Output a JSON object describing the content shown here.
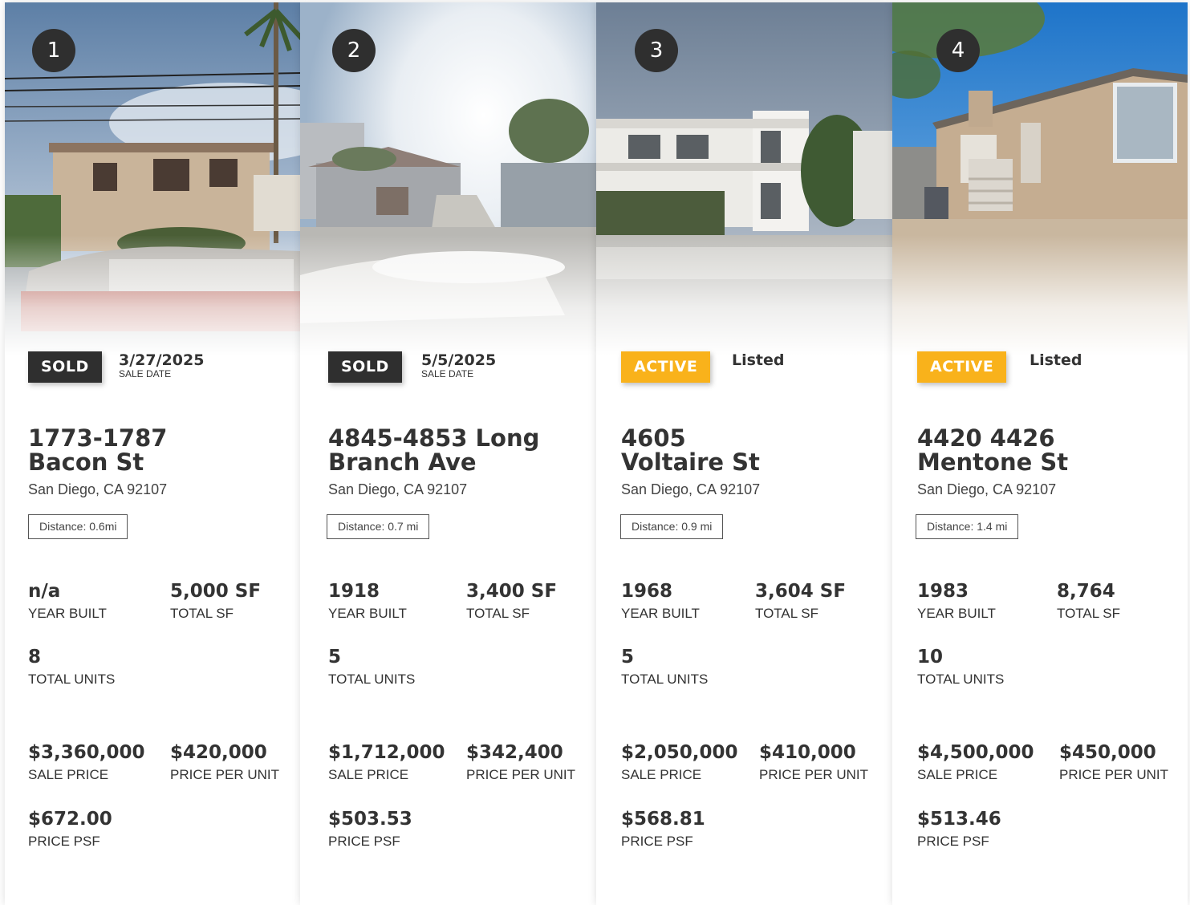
{
  "cards": [
    {
      "number": "1",
      "status": "SOLD",
      "date_value": "3/27/2025",
      "date_label": "SALE DATE",
      "address_line1": "1773-1787",
      "address_line2": "Bacon St",
      "city": "San Diego, CA 92107",
      "distance": "Distance: 0.6mi",
      "year_built": "n/a",
      "year_built_label": "YEAR BUILT",
      "total_sf": "5,000 SF",
      "total_sf_label": "TOTAL SF",
      "total_units": "8",
      "total_units_label": "TOTAL UNITS",
      "sale_price": "$3,360,000",
      "sale_price_label": "SALE PRICE",
      "price_per_unit": "$420,000",
      "price_per_unit_label": "PRICE PER UNIT",
      "price_psf": "$672.00",
      "price_psf_label": "PRICE PSF"
    },
    {
      "number": "2",
      "status": "SOLD",
      "date_value": "5/5/2025",
      "date_label": "SALE DATE",
      "address_line1": "4845-4853 Long",
      "address_line2": "Branch Ave",
      "city": "San Diego, CA 92107",
      "distance": "Distance: 0.7 mi",
      "year_built": "1918",
      "year_built_label": "YEAR BUILT",
      "total_sf": "3,400 SF",
      "total_sf_label": "TOTAL SF",
      "total_units": "5",
      "total_units_label": "TOTAL UNITS",
      "sale_price": "$1,712,000",
      "sale_price_label": "SALE PRICE",
      "price_per_unit": "$342,400",
      "price_per_unit_label": "PRICE PER UNIT",
      "price_psf": "$503.53",
      "price_psf_label": "PRICE PSF"
    },
    {
      "number": "3",
      "status": "ACTIVE",
      "date_value": "Listed",
      "date_label": "",
      "address_line1": "4605",
      "address_line2": "Voltaire St",
      "city": "San Diego, CA 92107",
      "distance": "Distance: 0.9 mi",
      "year_built": "1968",
      "year_built_label": "YEAR BUILT",
      "total_sf": "3,604 SF",
      "total_sf_label": "TOTAL SF",
      "total_units": "5",
      "total_units_label": "TOTAL UNITS",
      "sale_price": "$2,050,000",
      "sale_price_label": "SALE PRICE",
      "price_per_unit": "$410,000",
      "price_per_unit_label": "PRICE PER UNIT",
      "price_psf": "$568.81",
      "price_psf_label": "PRICE PSF"
    },
    {
      "number": "4",
      "status": "ACTIVE",
      "date_value": "Listed",
      "date_label": "",
      "address_line1": "4420 4426",
      "address_line2": "Mentone St",
      "city": "San Diego, CA 92107",
      "distance": "Distance: 1.4 mi",
      "year_built": "1983",
      "year_built_label": "YEAR BUILT",
      "total_sf": "8,764",
      "total_sf_label": "TOTAL SF",
      "total_units": "10",
      "total_units_label": "TOTAL UNITS",
      "sale_price": "$4,500,000",
      "sale_price_label": "SALE PRICE",
      "price_per_unit": "$450,000",
      "price_per_unit_label": "PRICE PER UNIT",
      "price_psf": "$513.46",
      "price_psf_label": "PRICE PSF"
    }
  ],
  "colors": {
    "sold_badge": "#2f2f2f",
    "active_badge": "#f9b21b",
    "text": "#333333"
  }
}
